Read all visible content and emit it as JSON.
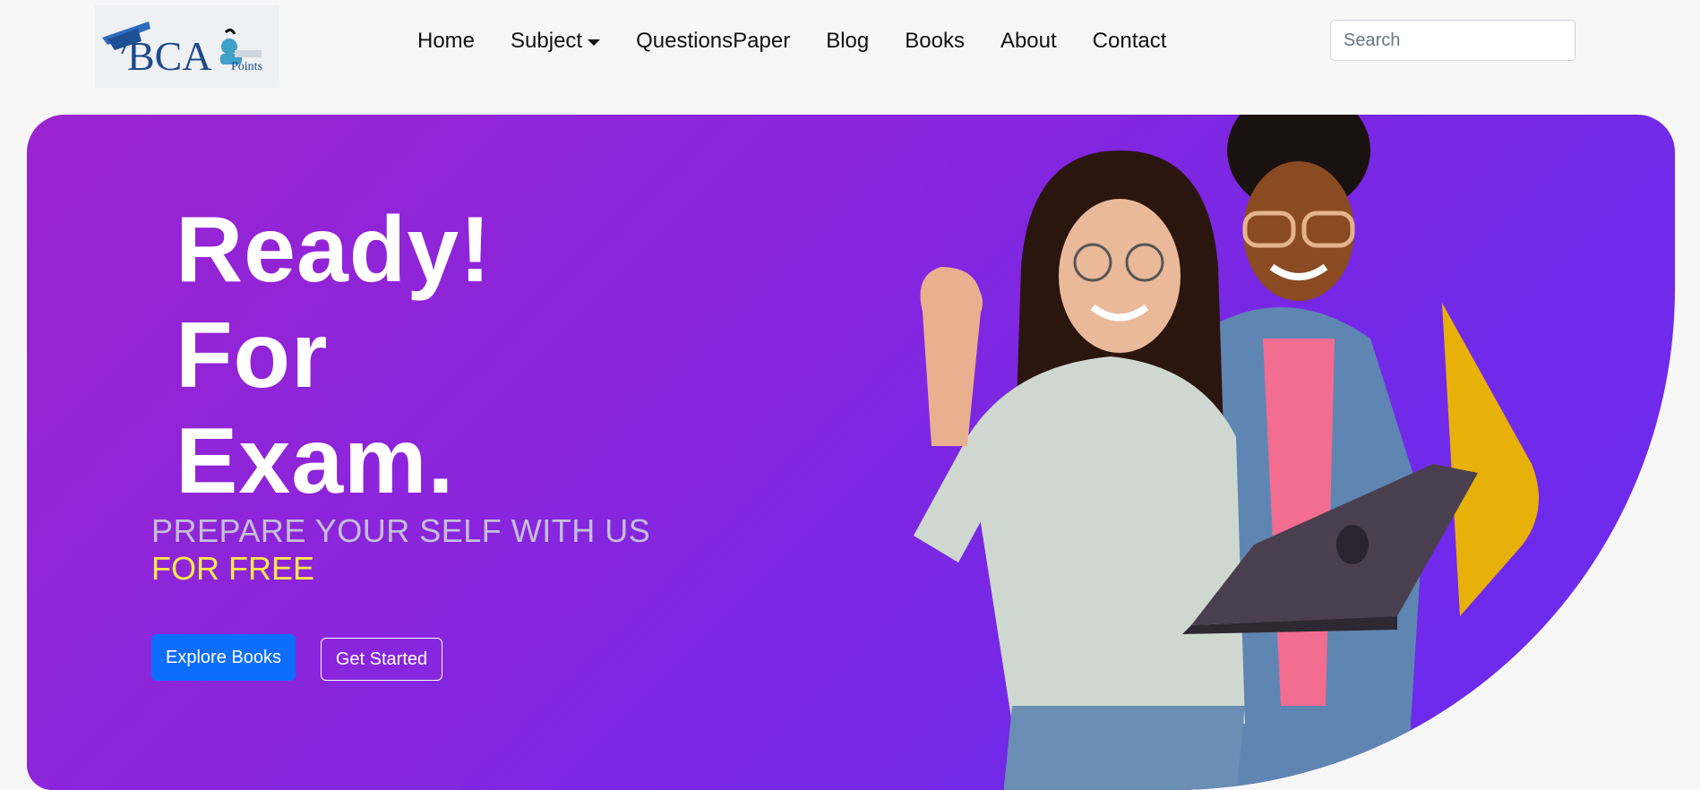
{
  "logo": {
    "text": "BCA",
    "subtext": "Points"
  },
  "nav": {
    "items": [
      {
        "label": "Home"
      },
      {
        "label": "Subject",
        "dropdown": true
      },
      {
        "label": "QuestionsPaper"
      },
      {
        "label": "Blog"
      },
      {
        "label": "Books"
      },
      {
        "label": "About"
      },
      {
        "label": "Contact"
      }
    ]
  },
  "search": {
    "placeholder": "Search",
    "value": ""
  },
  "hero": {
    "headline": [
      "Ready!",
      "For",
      "Exam."
    ],
    "tagline": "PREPARE YOUR SELF WITH US",
    "free_text": "FOR FREE",
    "primary_button": "Explore Books",
    "secondary_button": "Get Started"
  },
  "colors": {
    "hero_gradient_start": "#9a24d0",
    "hero_gradient_end": "#6a2cf0",
    "primary": "#0d6efd",
    "accent_yellow": "#ffe94a",
    "accent_gold": "#e8b10a"
  }
}
